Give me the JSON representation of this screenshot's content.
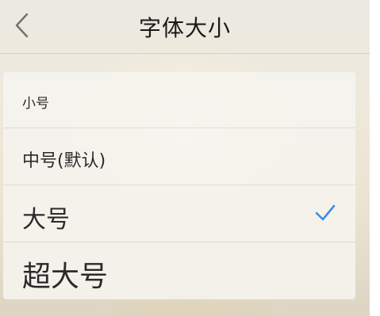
{
  "header": {
    "title": "字体大小",
    "back_icon": "chevron-left-icon"
  },
  "font_size_options": [
    {
      "label": "小号",
      "selected": false
    },
    {
      "label": "中号(默认)",
      "selected": false
    },
    {
      "label": "大号",
      "selected": true
    },
    {
      "label": "超大号",
      "selected": false
    }
  ],
  "colors": {
    "check": "#3a8ee6",
    "title": "#1a1a1a",
    "label": "#2a2a2a"
  }
}
